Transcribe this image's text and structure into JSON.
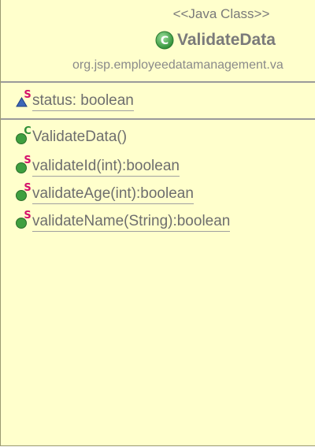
{
  "class_box": {
    "stereotype": "<<Java Class>>",
    "name": "ValidateData",
    "package": "org.jsp.employeedatamanagement.va",
    "class_icon": "class-c-icon",
    "colors": {
      "fill": "#ffffcc",
      "text": "#7a7a7a",
      "class_icon": "#3aa142",
      "static_marker": "#d4106a",
      "method_icon": "#3f9f3f",
      "field_icon": "#2b57a6"
    }
  },
  "attributes": [
    {
      "text": "status: boolean",
      "icon": "private-static-field-icon",
      "static": true
    }
  ],
  "operations": [
    {
      "text": "ValidateData()",
      "icon": "public-constructor-icon",
      "static": false
    },
    {
      "text": "validateId(int):boolean",
      "icon": "public-static-method-icon",
      "static": true
    },
    {
      "text": "validateAge(int):boolean",
      "icon": "public-static-method-icon",
      "static": true
    },
    {
      "text": "validateName(String):boolean",
      "icon": "public-static-method-icon",
      "static": true
    }
  ]
}
